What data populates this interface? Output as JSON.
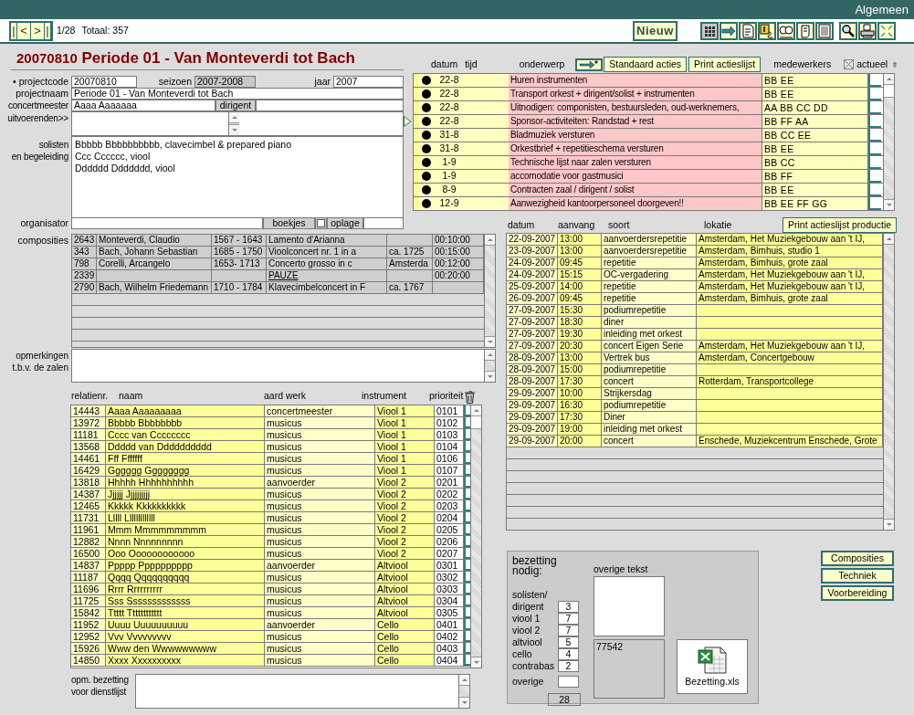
{
  "window": {
    "title": "Algemeen"
  },
  "navigation": {
    "buttons": [
      "|",
      "<",
      ">",
      "|"
    ],
    "record": "1/28",
    "total": "Totaal: 357"
  },
  "toolbar": {
    "new_button": "Nieuw",
    "buttons": [
      {
        "kind": "grid",
        "selected": true
      },
      {
        "kind": "arrow",
        "selected": false
      },
      {
        "kind": "document",
        "selected": false
      },
      {
        "kind": "card",
        "selected": false
      },
      {
        "kind": "people",
        "selected": false
      },
      {
        "kind": "scroll",
        "selected": false
      },
      {
        "kind": "list",
        "selected": false
      },
      {
        "kind": "search",
        "selected": false
      },
      {
        "kind": "printer",
        "selected": false
      },
      {
        "kind": "expand",
        "selected": false
      }
    ]
  },
  "header": {
    "code": "20070810",
    "title": "Periode 01 - Van Monteverdi tot Bach"
  },
  "form": {
    "projectcode": {
      "label": "• projectcode",
      "value": "20070810"
    },
    "seizoen": {
      "label": "seizoen",
      "value": "2007-2008"
    },
    "jaar": {
      "label": "jaar",
      "value": "2007"
    },
    "projectnaam": {
      "label": "projectnaam",
      "value": "Periode 01 - Van Monteverdi tot Bach"
    },
    "concertmeester": {
      "label": "concertmeester",
      "value": "Aaaa Aaaaaaa"
    },
    "dirigent": {
      "label": "dirigent"
    },
    "uitvoerenden": {
      "label": "uitvoerenden>>"
    },
    "solisten": {
      "label": [
        "solisten",
        "en begeleiding"
      ],
      "lines": [
        "Bbbbb Bbbbbbbbbb, clavecimbel & prepared piano",
        "Ccc Cccccc, viool",
        "Dddddd Ddddddd, viool"
      ]
    },
    "organisator": {
      "label": "organisator"
    },
    "boekjes": {
      "label": "boekjes",
      "checked": false
    },
    "oplage": {
      "label": "oplage"
    }
  },
  "actions": {
    "columns": [
      "datum",
      "tijd",
      "onderwerp"
    ],
    "buttons": [
      "Standaard acties",
      "Print actieslijst"
    ],
    "staff_label": "medewerkers",
    "actueel": {
      "label": "actueel",
      "checked": true
    },
    "rows": [
      {
        "date": "22-8",
        "subject": "Huren instrumenten",
        "staff": "BB EE",
        "checked": false
      },
      {
        "date": "22-8",
        "subject": "Transport orkest + dirigent/solist + instrumenten",
        "staff": "BB EE",
        "checked": false
      },
      {
        "date": "22-8",
        "subject": "Uitnodigen: componisten, bestuursleden, oud-werknemers,",
        "staff": "AA BB CC DD",
        "checked": false
      },
      {
        "date": "22-8",
        "subject": "Sponsor-activiteiten: Randstad + rest",
        "staff": "BB FF AA",
        "checked": false
      },
      {
        "date": "31-8",
        "subject": "Bladmuziek versturen",
        "staff": "BB CC EE",
        "checked": false
      },
      {
        "date": "31-8",
        "subject": "Orkestbrief + repetitieschema versturen",
        "staff": "BB EE",
        "checked": false
      },
      {
        "date": "1-9",
        "subject": "Technische lijst naar zalen versturen",
        "staff": "BB CC",
        "checked": false
      },
      {
        "date": "1-9",
        "subject": "accomodatie voor gastmusici",
        "staff": "BB FF",
        "checked": false
      },
      {
        "date": "8-9",
        "subject": "Contracten zaal / dirigent / solist",
        "staff": "BB EE",
        "checked": false
      },
      {
        "date": "12-9",
        "subject": "Aanwezigheid kantoorpersoneel doorgeven!!",
        "staff": "BB EE FF GG",
        "checked": false
      }
    ]
  },
  "compositions": {
    "label": "composities",
    "rows": [
      {
        "kind": "work",
        "cells": [
          "2643",
          "Monteverdi, Claudio",
          "1567 - 1643",
          "Lamento d'Arianna",
          "",
          "00:10:00"
        ]
      },
      {
        "kind": "work",
        "cells": [
          "343",
          "Bach, Johann Sebastian",
          "1685 - 1750",
          "Vioolconcert nr. 1 in a",
          "ca. 1725",
          "00:15:00"
        ]
      },
      {
        "kind": "work",
        "cells": [
          "798",
          "Corelli, Arcangelo",
          "1653- 1713",
          "Concerto grosso in c",
          "Amsterda",
          "00:12:00"
        ]
      },
      {
        "kind": "pause",
        "cells": [
          "2339",
          "",
          "",
          "PAUZE",
          "",
          "00:20:00"
        ]
      },
      {
        "kind": "work",
        "cells": [
          "2790",
          "Bach, Wilhelm Friedemann",
          "1710 - 1784",
          "Klavecimbelconcert in F",
          "ca. 1767",
          ""
        ]
      }
    ]
  },
  "remarks": {
    "label": [
      "opmerkingen",
      "t.b.v. de zalen"
    ]
  },
  "events": {
    "columns": [
      "datum",
      "aanvang",
      "soort",
      "lokatie"
    ],
    "print_button": "Print actieslijst productie",
    "rows": [
      [
        "22-09-2007",
        "13:00",
        "aanvoerdersrepetitie",
        "Amsterdam, Het Muziekgebouw aan 't IJ,"
      ],
      [
        "23-09-2007",
        "13:00",
        "aanvoerdersrepetitie",
        "Amsterdam, Bimhuis, studio 1"
      ],
      [
        "24-09-2007",
        "09:45",
        "repetitie",
        "Amsterdam, Bimhuis, grote zaal"
      ],
      [
        "24-09-2007",
        "15:15",
        "OC-vergadering",
        "Amsterdam, Het Muziekgebouw aan 't IJ,"
      ],
      [
        "25-09-2007",
        "14:00",
        "repetitie",
        "Amsterdam, Het Muziekgebouw aan 't IJ,"
      ],
      [
        "26-09-2007",
        "09:45",
        "repetitie",
        "Amsterdam, Bimhuis, grote zaal"
      ],
      [
        "27-09-2007",
        "15:30",
        "podiumrepetitie",
        ""
      ],
      [
        "27-09-2007",
        "18:30",
        "diner",
        ""
      ],
      [
        "27-09-2007",
        "19:30",
        "inleiding met orkest",
        ""
      ],
      [
        "27-09-2007",
        "20:30",
        "concert Eigen Serie",
        "Amsterdam, Het Muziekgebouw aan 't IJ,"
      ],
      [
        "28-09-2007",
        "13:00",
        "Vertrek bus",
        "Amsterdam, Concertgebouw"
      ],
      [
        "28-09-2007",
        "15:00",
        "podiumrepetitie",
        ""
      ],
      [
        "28-09-2007",
        "17:30",
        "concert",
        "Rotterdam, Transportcollege"
      ],
      [
        "29-09-2007",
        "10:00",
        "Strijkersdag",
        ""
      ],
      [
        "29-09-2007",
        "16:30",
        "podiumrepetitie",
        ""
      ],
      [
        "29-09-2007",
        "17:30",
        "Diner",
        ""
      ],
      [
        "29-09-2007",
        "19:00",
        "inleiding met orkest",
        ""
      ],
      [
        "29-09-2007",
        "20:00",
        "concert",
        "Enschede, Muziekcentrum Enschede, Grote"
      ]
    ]
  },
  "musicians": {
    "columns": [
      "relatienr.",
      "naam",
      "aard werk",
      "instrument",
      "prioriteit"
    ],
    "rows": [
      [
        "14443",
        "Aaaa Aaaaaaaaa",
        "concertmeester",
        "Viool 1",
        "0101"
      ],
      [
        "13972",
        "Bbbbb Bbbbbbbb",
        "musicus",
        "Viool 1",
        "0102"
      ],
      [
        "11181",
        "Cccc van Cccccccc",
        "musicus",
        "Viool 1",
        "0103"
      ],
      [
        "13568",
        "Ddddd van Dddddddddd",
        "musicus",
        "Viool 1",
        "0104"
      ],
      [
        "14461",
        "Fff Fffffff",
        "musicus",
        "Viool 1",
        "0106"
      ],
      [
        "16429",
        "Gggggg Gggggggg",
        "musicus",
        "Viool 1",
        "0107"
      ],
      [
        "13818",
        "Hhhhh Hhhhhhhhhh",
        "aanvoerder",
        "Viool 2",
        "0201"
      ],
      [
        "14387",
        "Jjjjjj Jjjjjjjjjj",
        "musicus",
        "Viool 2",
        "0202"
      ],
      [
        "12465",
        "Kkkkk Kkkkkkkkkk",
        "musicus",
        "Viool 2",
        "0203"
      ],
      [
        "11731",
        "Lllll Lllllllllllll",
        "musicus",
        "Viool 2",
        "0204"
      ],
      [
        "11961",
        "Mmm Mmmmmmmmm",
        "musicus",
        "Viool 2",
        "0205"
      ],
      [
        "12882",
        "Nnnn Nnnnnnnnn",
        "musicus",
        "Viool 2",
        "0206"
      ],
      [
        "16500",
        "Ooo Oooooooooooo",
        "musicus",
        "Viool 2",
        "0207"
      ],
      [
        "14837",
        "Ppppp Pppppppppp",
        "aanvoerder",
        "Altviool",
        "0301"
      ],
      [
        "11187",
        "Qqqq Qqqqqqqqqq",
        "musicus",
        "Altviool",
        "0302"
      ],
      [
        "11696",
        "Rrrr Rrrrrrrrrr",
        "musicus",
        "Altviool",
        "0303"
      ],
      [
        "11725",
        "Sss Sssssssssssss",
        "musicus",
        "Altviool",
        "0304"
      ],
      [
        "15842",
        "Ttttt Tttttttttttt",
        "musicus",
        "Altviool",
        "0305"
      ],
      [
        "11952",
        "Uuuu Uuuuuuuuuu",
        "aanvoerder",
        "Cello",
        "0401"
      ],
      [
        "12952",
        "Vvv Vvvvvvvvv",
        "musicus",
        "Cello",
        "0402"
      ],
      [
        "15926",
        "Www den Wwwwwwwww",
        "musicus",
        "Cello",
        "0403"
      ],
      [
        "14850",
        "Xxxx Xxxxxxxxxx",
        "musicus",
        "Cello",
        "0404"
      ]
    ]
  },
  "bezetting_remark": {
    "label": [
      "opm. bezetting",
      "voor dienstlijst"
    ]
  },
  "bezetting": {
    "title": [
      "bezetting",
      "nodig:"
    ],
    "counts": [
      {
        "label": "solisten/ dirigent",
        "value": "3"
      },
      {
        "label": "viool 1",
        "value": "7"
      },
      {
        "label": "viool 2",
        "value": "7"
      },
      {
        "label": "altviool",
        "value": "5"
      },
      {
        "label": "cello",
        "value": "4"
      },
      {
        "label": "contrabas",
        "value": "2"
      },
      {
        "label": "overige"
      }
    ],
    "total": "28",
    "other_label": "overige tekst",
    "code": "77542",
    "file": "Bezetting.xls"
  },
  "side_buttons": [
    "Composities",
    "Techniek",
    "Voorbereiding"
  ]
}
